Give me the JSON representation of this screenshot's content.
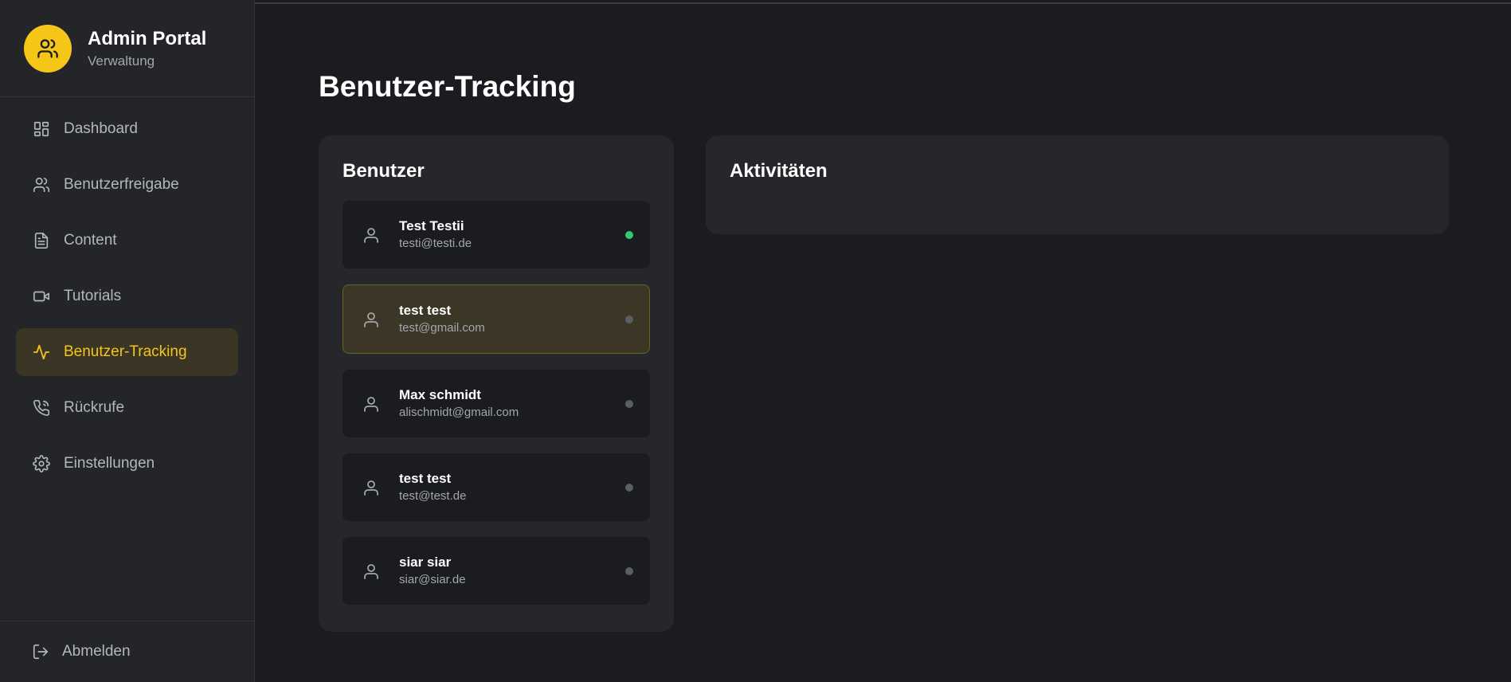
{
  "brand": {
    "title": "Admin Portal",
    "subtitle": "Verwaltung"
  },
  "sidebar": {
    "items": [
      {
        "label": "Dashboard",
        "icon": "dashboard-icon",
        "active": false
      },
      {
        "label": "Benutzerfreigabe",
        "icon": "users-icon",
        "active": false
      },
      {
        "label": "Content",
        "icon": "document-icon",
        "active": false
      },
      {
        "label": "Tutorials",
        "icon": "video-icon",
        "active": false
      },
      {
        "label": "Benutzer-Tracking",
        "icon": "activity-icon",
        "active": true
      },
      {
        "label": "Rückrufe",
        "icon": "phone-icon",
        "active": false
      },
      {
        "label": "Einstellungen",
        "icon": "gear-icon",
        "active": false
      }
    ],
    "logout_label": "Abmelden"
  },
  "page": {
    "title": "Benutzer-Tracking"
  },
  "users_card": {
    "title": "Benutzer",
    "users": [
      {
        "name": "Test Testii",
        "email": "testi@testi.de",
        "status": "online",
        "selected": false
      },
      {
        "name": "test test",
        "email": "test@gmail.com",
        "status": "offline",
        "selected": true
      },
      {
        "name": "Max schmidt",
        "email": "alischmidt@gmail.com",
        "status": "offline",
        "selected": false
      },
      {
        "name": "test test",
        "email": "test@test.de",
        "status": "offline",
        "selected": false
      },
      {
        "name": "siar siar",
        "email": "siar@siar.de",
        "status": "offline",
        "selected": false
      }
    ]
  },
  "activities_card": {
    "title": "Aktivitäten"
  },
  "colors": {
    "accent": "#f5c518",
    "online": "#2ecc71",
    "offline": "#5a5d64",
    "background": "#1b1c1f",
    "panel": "#26272b"
  }
}
